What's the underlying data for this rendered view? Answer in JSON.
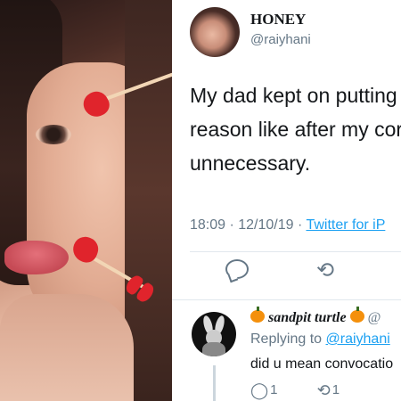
{
  "tweet": {
    "display_name": "HONEY",
    "handle": "@raiyhani",
    "text_lines": [
      "My dad kept on putting",
      "reason like after my cor",
      "unnecessary."
    ],
    "timestamp": "18:09 · 12/10/19 ·",
    "source": "Twitter for iP"
  },
  "reply": {
    "display_name": "sandpit turtle",
    "extra": "@",
    "replying_prefix": "Replying to",
    "replying_to": "@raiyhani",
    "text": "did u mean convocatio",
    "reply_count": "1",
    "retweet_count": "1"
  },
  "icons": {
    "reply": "reply-bubble-icon",
    "retweet": "retweet-icon"
  },
  "colors": {
    "link": "#1da1f2",
    "secondary_text": "#657786",
    "heart_arrow": "#e0242c"
  }
}
